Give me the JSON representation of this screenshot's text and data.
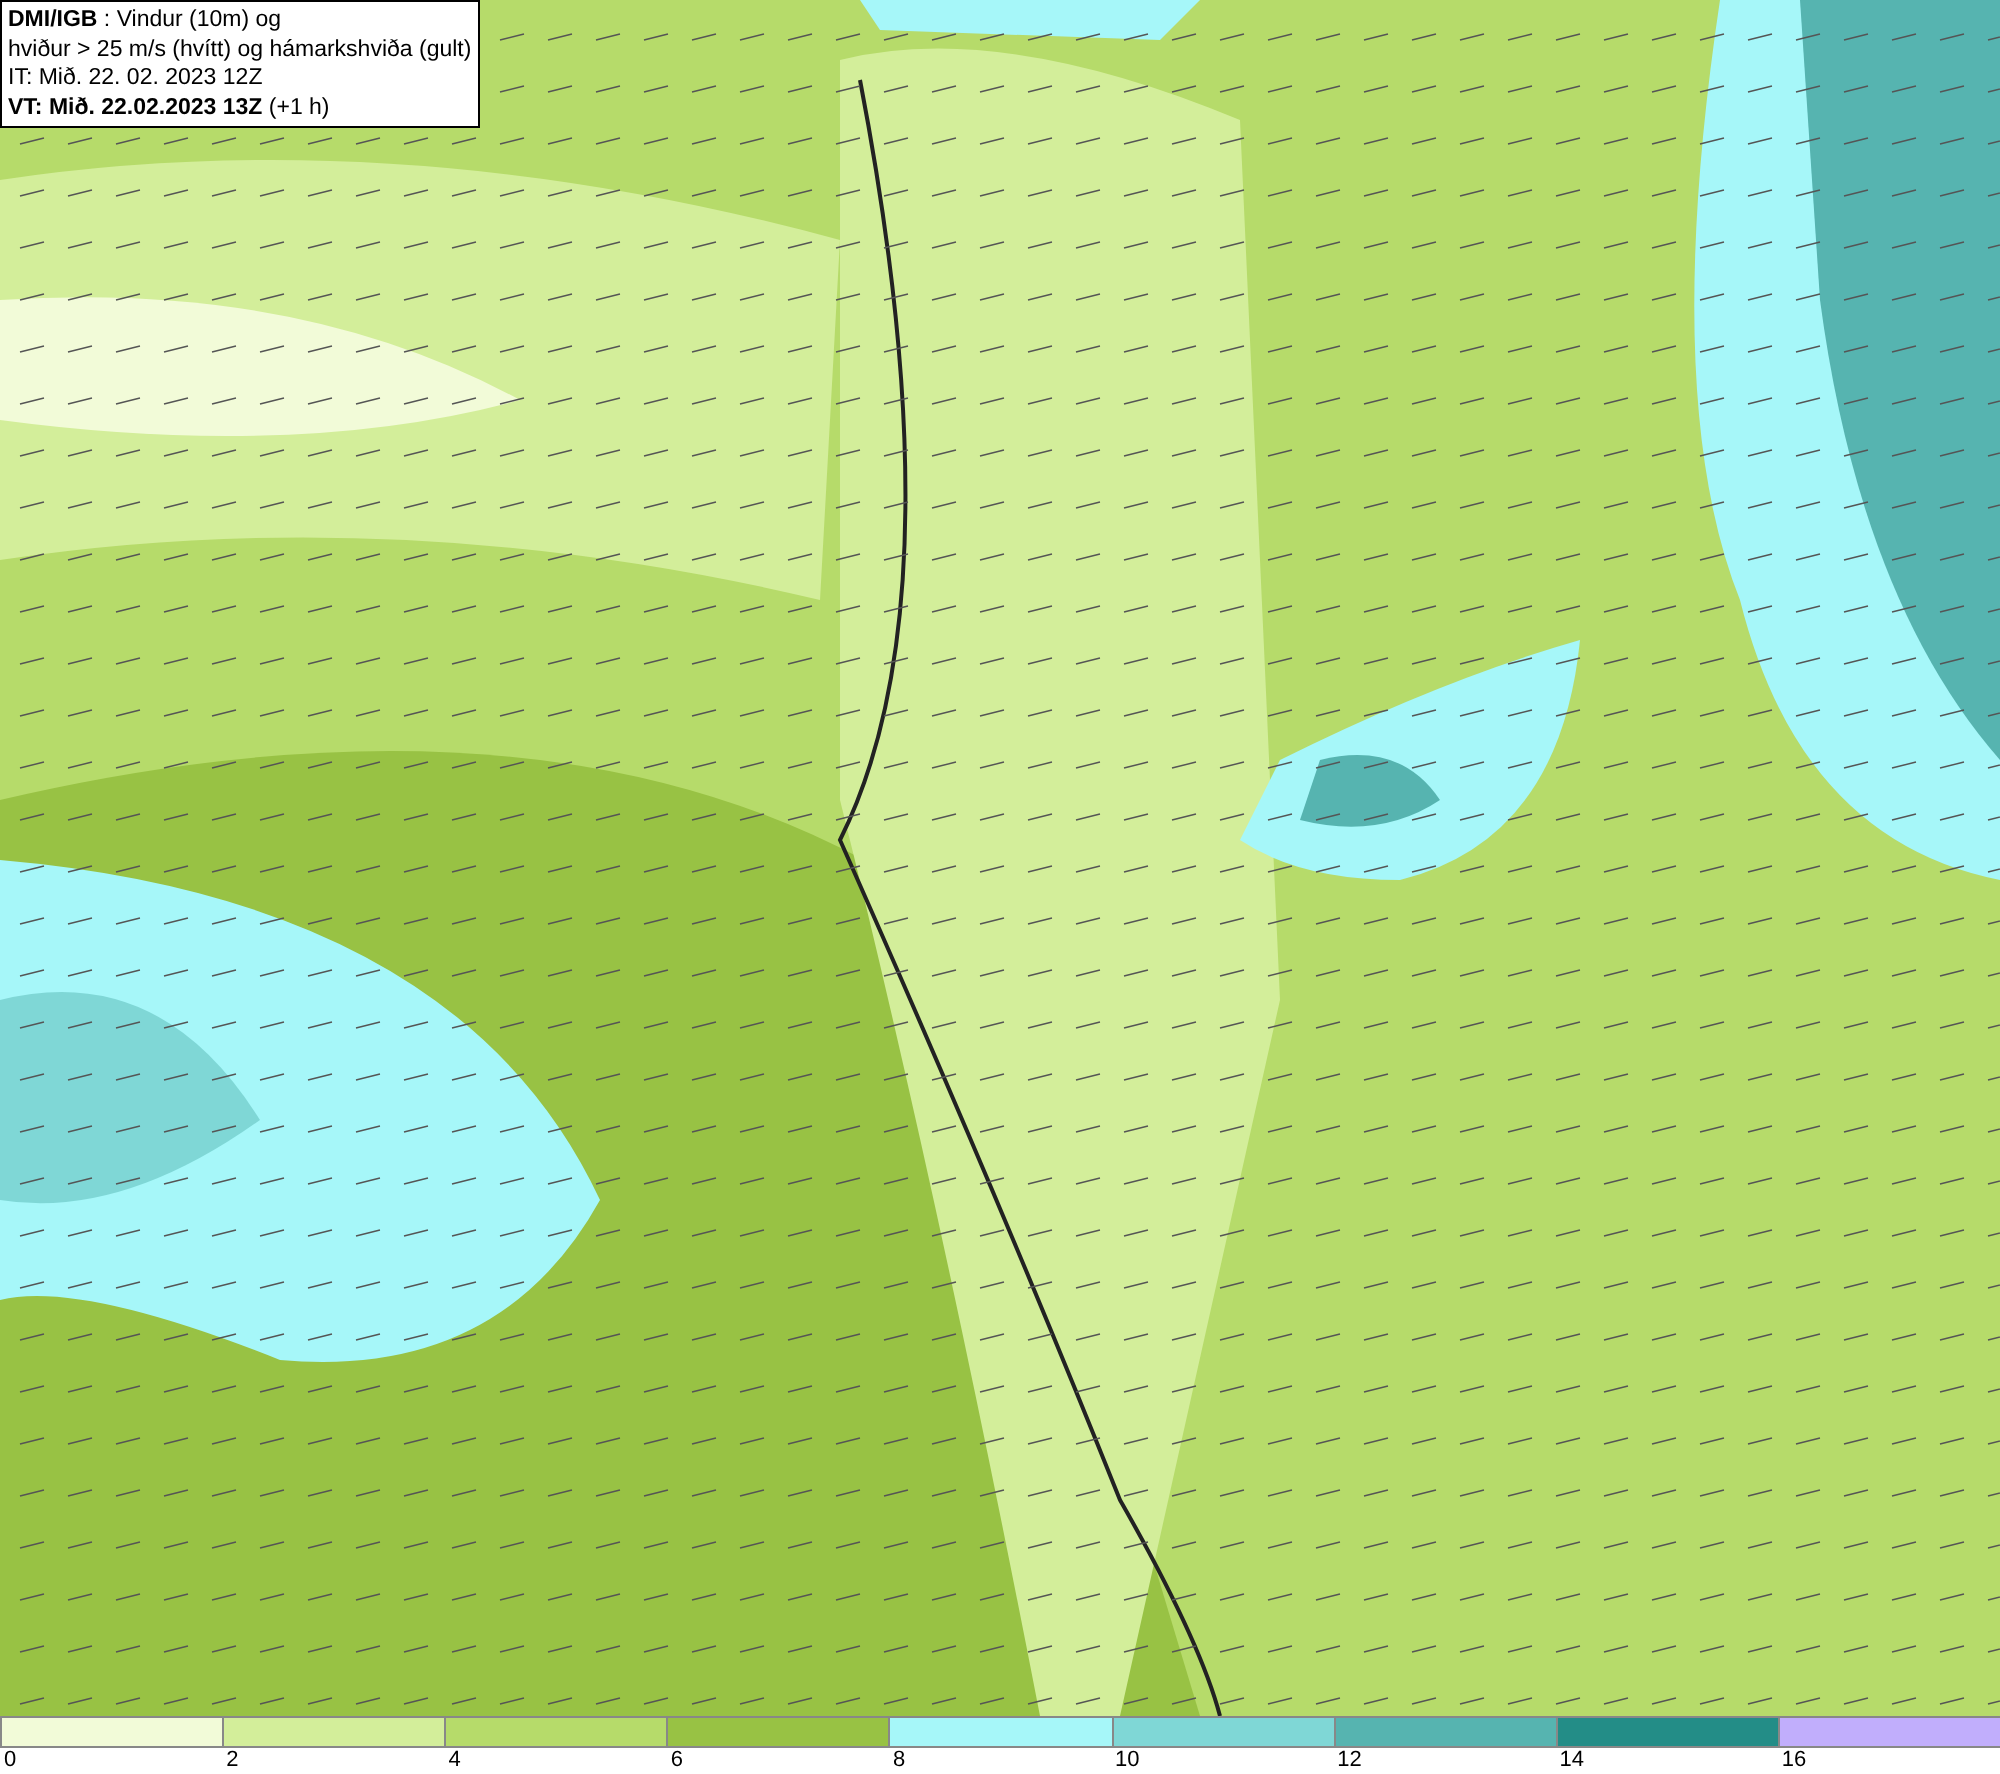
{
  "header": {
    "lines": [
      "**DMI/IGB** : Vindur (10m) og",
      "hviður > 25 m/s (hvítt) og hámarkshviða (gult)",
      "IT: Mið. 22. 02. 2023 12Z",
      "**VT: Mið. 22.02.2023 13Z** (+1 h)"
    ]
  },
  "legend": [
    {
      "color": "#f2fbd8",
      "label": "0"
    },
    {
      "color": "#d3ee9a",
      "label": "2"
    },
    {
      "color": "#b6db6a",
      "label": "4"
    },
    {
      "color": "#98c244",
      "label": "6"
    },
    {
      "color": "#a6f7f9",
      "label": "8"
    },
    {
      "color": "#7fd7d6",
      "label": "10"
    },
    {
      "color": "#56b4b0",
      "label": "12"
    },
    {
      "color": "#238d87",
      "label": "14"
    },
    {
      "color": "#c1aefc",
      "label": "16"
    }
  ]
}
